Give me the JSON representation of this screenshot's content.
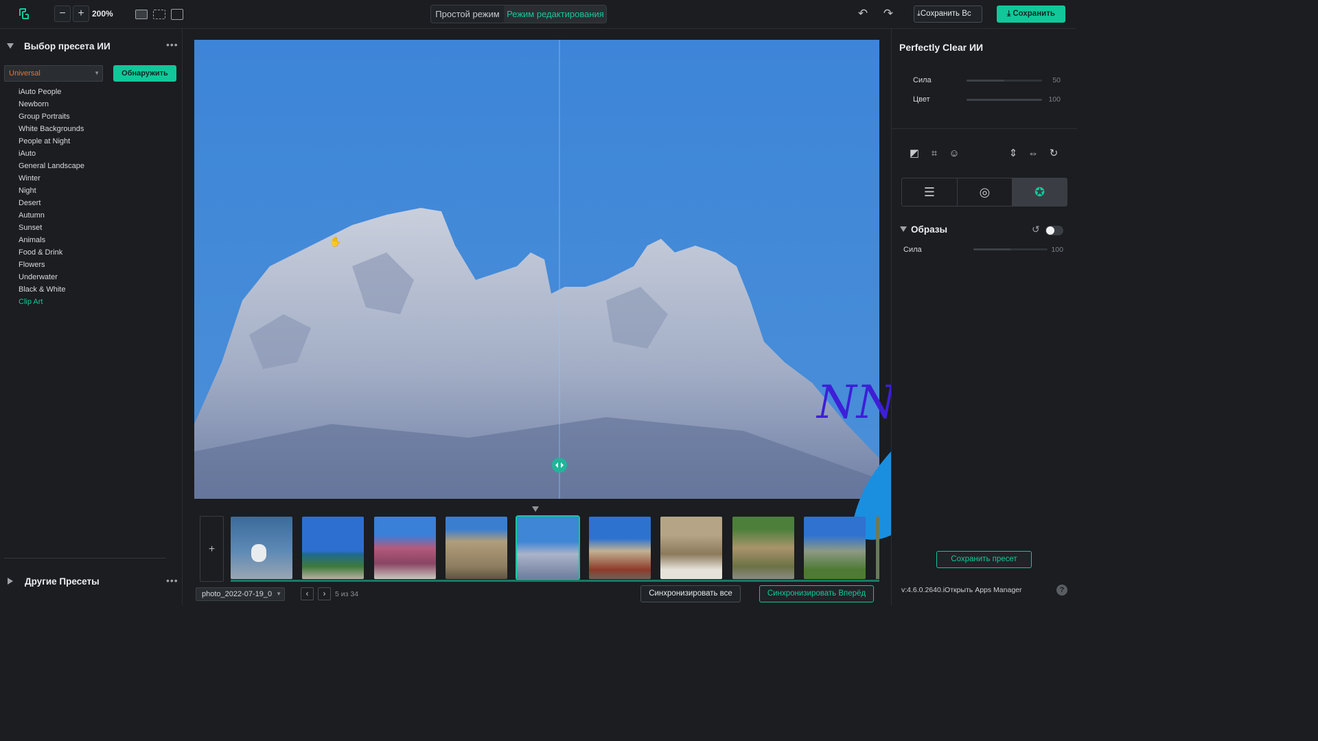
{
  "toolbar": {
    "zoom_level": "200%",
    "zoom_out_label": "−",
    "zoom_in_label": "+",
    "mode_simple": "Простой режим",
    "mode_edit": "Режим редактирования",
    "save_all_label": "Сохранить Вс",
    "save_label": "Сохранить",
    "accent_color": "#12c79a"
  },
  "left_panel": {
    "ai_preset_title": "Выбор пресета ИИ",
    "preset_select_value": "Universal",
    "detect_button": "Обнаружить",
    "presets": [
      "iAuto People",
      "Newborn",
      "Group Portraits",
      "White Backgrounds",
      "People at Night",
      "iAuto",
      "General Landscape",
      "Winter",
      "Night",
      "Desert",
      "Autumn",
      "Sunset",
      "Animals",
      "Food & Drink",
      "Flowers",
      "Underwater",
      "Black & White",
      "Clip Art"
    ],
    "active_preset": "Clip Art",
    "other_presets_title": "Другие Пресеты"
  },
  "watermark": {
    "text": "NNMClub"
  },
  "filmstrip": {
    "add_label": "+",
    "thumbnails": 9,
    "selected_index": 4
  },
  "bottom_bar": {
    "filename": "photo_2022-07-19_0",
    "page_info": "5 из 34",
    "sync_all": "Синхронизировать все",
    "sync_forward": "Синхронизировать Вперёд"
  },
  "right_panel": {
    "title": "Perfectly Clear ИИ",
    "strength_label": "Сила",
    "strength_value": "50",
    "color_label": "Цвет",
    "color_value": "100",
    "looks_title": "Образы",
    "looks_strength_label": "Сила",
    "looks_strength_value": "100",
    "save_preset": "Сохранить пресет",
    "version_text": "v:4.6.0.2640.iОткрыть Apps Manager",
    "help_label": "?"
  }
}
